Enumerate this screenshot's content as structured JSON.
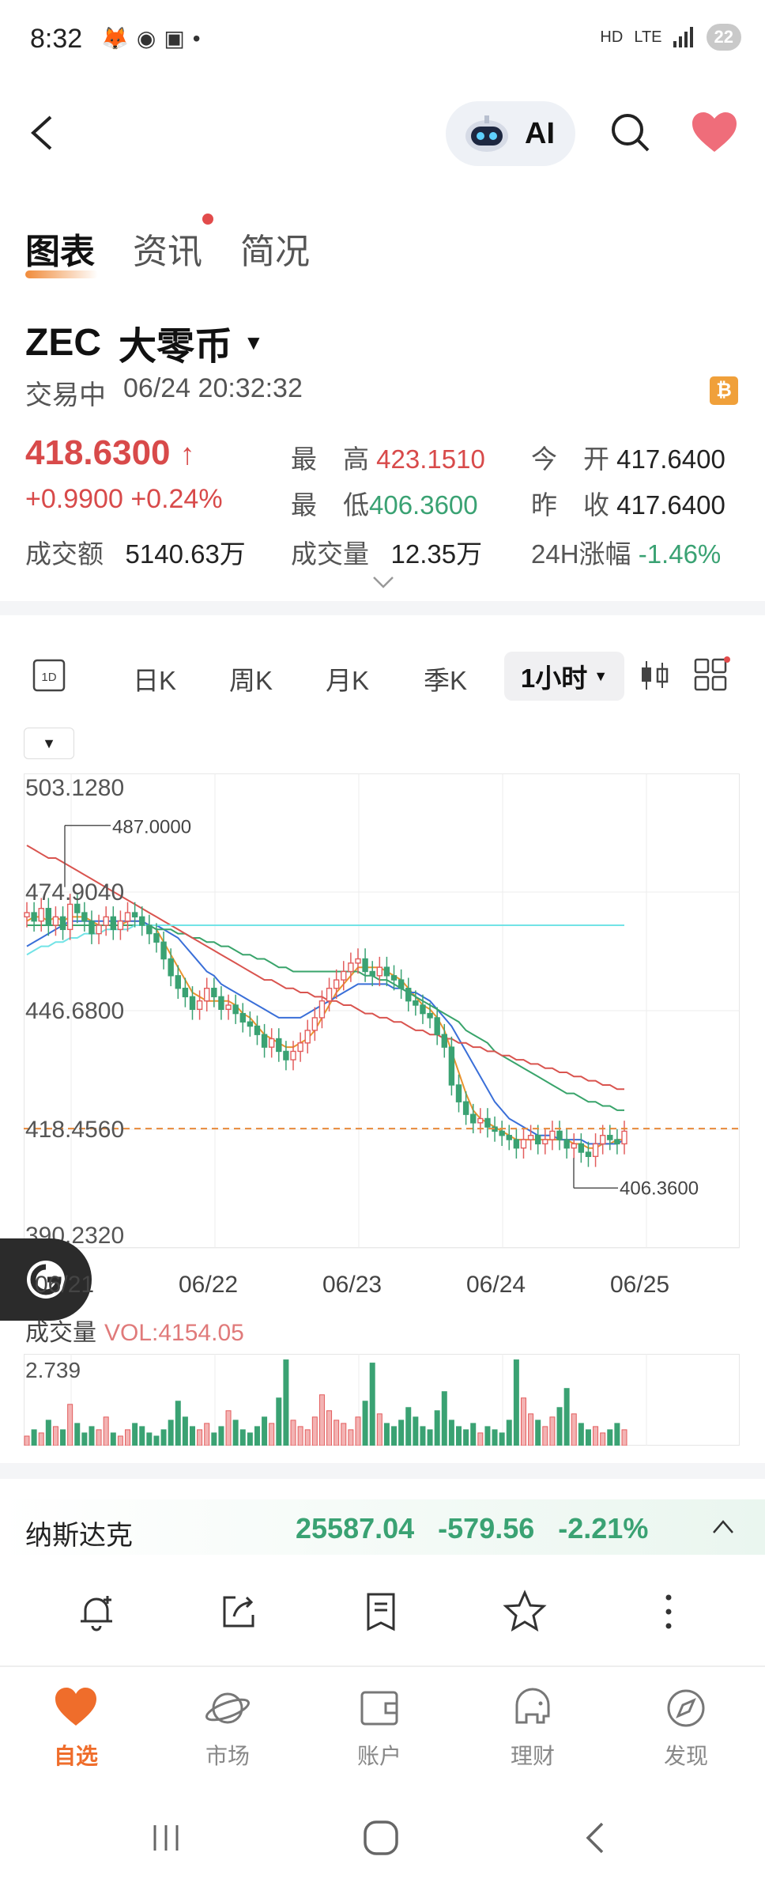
{
  "status_bar": {
    "time": "8:32",
    "network": "HD",
    "lte": "LTE",
    "battery": "22"
  },
  "header": {
    "ai_label": "AI"
  },
  "tabs": [
    {
      "label": "图表",
      "active": true
    },
    {
      "label": "资讯",
      "has_dot": true
    },
    {
      "label": "简况"
    }
  ],
  "ticker": {
    "symbol": "ZEC",
    "name": "大零币",
    "status": "交易中",
    "datetime": "06/24 20:32:32",
    "coin_badge": "₿"
  },
  "quote": {
    "price": "418.6300",
    "arrow": "↑",
    "change": "+0.9900",
    "change_pct": "+0.24%",
    "high_label": "最　高",
    "high": "423.1510",
    "low_label": "最　低",
    "low": "406.3600",
    "open_label": "今　开",
    "open": "417.6400",
    "prev_label": "昨　收",
    "prev_close": "417.6400",
    "turnover_label": "成交额",
    "turnover": "5140.63万",
    "volume_label": "成交量",
    "volume": "12.35万",
    "chg24_label": "24H涨幅",
    "chg24": "-1.46%"
  },
  "chart_toolbar": {
    "period_icon_label": "1D",
    "items": [
      "日K",
      "周K",
      "月K",
      "季K"
    ],
    "selected": "1小时"
  },
  "chart_data": {
    "type": "candlestick",
    "price_ticks": [
      "503.1280",
      "474.9040",
      "446.6800",
      "418.4560",
      "390.2320"
    ],
    "date_ticks": [
      "06/21",
      "06/22",
      "06/23",
      "06/24",
      "06/25"
    ],
    "ylim": [
      390.232,
      503.128
    ],
    "max_annotation": "487.0000",
    "min_annotation": "406.3600",
    "current_price_line": 418.63,
    "close_series": [
      470,
      468,
      471,
      467,
      469,
      466,
      472,
      470,
      468,
      465,
      467,
      469,
      466,
      468,
      470,
      469,
      467,
      465,
      463,
      459,
      455,
      452,
      450,
      447,
      449,
      452,
      450,
      447,
      448,
      446,
      444,
      443,
      441,
      438,
      440,
      437,
      435,
      437,
      439,
      442,
      445,
      449,
      452,
      454,
      456,
      458,
      459,
      456,
      455,
      457,
      455,
      454,
      452,
      449,
      448,
      446,
      445,
      441,
      438,
      429,
      425,
      422,
      420,
      421,
      419,
      418,
      417,
      416,
      414,
      416,
      417,
      415,
      416,
      418,
      416,
      414,
      415,
      413,
      412,
      415,
      417,
      416,
      415,
      418
    ],
    "ma_series": [
      {
        "name": "MA5",
        "color": "#e8932e",
        "values": [
          468,
          469,
          469,
          468,
          469,
          468,
          469,
          469,
          469,
          468,
          467,
          467,
          467,
          467,
          468,
          468,
          468,
          467,
          466,
          463,
          460,
          457,
          454,
          451,
          450,
          449,
          449,
          449,
          449,
          448,
          446,
          445,
          443,
          441,
          440,
          439,
          438,
          438,
          439,
          440,
          442,
          445,
          448,
          451,
          453,
          455,
          457,
          457,
          457,
          457,
          456,
          455,
          454,
          452,
          450,
          448,
          447,
          445,
          442,
          437,
          432,
          427,
          423,
          421,
          420,
          419,
          418,
          417,
          416,
          416,
          416,
          416,
          416,
          416,
          416,
          416,
          415,
          415,
          414,
          414,
          415,
          415,
          416,
          416
        ]
      },
      {
        "name": "MA10",
        "color": "#3a6fd8",
        "values": [
          462,
          463,
          464,
          465,
          466,
          467,
          468,
          468,
          468,
          468,
          468,
          468,
          468,
          468,
          468,
          468,
          468,
          467,
          467,
          466,
          465,
          464,
          462,
          460,
          458,
          456,
          455,
          453,
          452,
          451,
          450,
          449,
          448,
          447,
          446,
          445,
          445,
          445,
          445,
          446,
          447,
          448,
          449,
          450,
          451,
          452,
          453,
          453,
          453,
          453,
          453,
          452,
          452,
          451,
          451,
          450,
          449,
          447,
          445,
          443,
          440,
          437,
          434,
          431,
          428,
          425,
          423,
          421,
          420,
          419,
          418,
          417,
          417,
          417,
          416,
          416,
          416,
          416,
          415,
          415,
          415,
          415,
          415,
          416
        ]
      },
      {
        "name": "MA30",
        "color": "#39a46b",
        "values": [
          467,
          467,
          467,
          467,
          467,
          467,
          467,
          467,
          467,
          467,
          467,
          467,
          467,
          467,
          467,
          467,
          467,
          467,
          466,
          466,
          466,
          465,
          465,
          464,
          464,
          463,
          463,
          462,
          462,
          461,
          460,
          460,
          459,
          459,
          458,
          457,
          457,
          456,
          456,
          456,
          456,
          456,
          456,
          456,
          456,
          456,
          456,
          455,
          455,
          454,
          454,
          453,
          452,
          451,
          450,
          449,
          448,
          447,
          446,
          445,
          444,
          442,
          441,
          440,
          439,
          437,
          436,
          435,
          434,
          433,
          432,
          431,
          430,
          429,
          428,
          427,
          427,
          426,
          425,
          425,
          424,
          424,
          423,
          423
        ]
      },
      {
        "name": "MA60",
        "color": "#d9544f",
        "values": [
          486,
          485,
          484,
          483,
          483,
          482,
          481,
          480,
          479,
          478,
          477,
          476,
          475,
          474,
          473,
          472,
          471,
          470,
          469,
          468,
          467,
          466,
          465,
          464,
          463,
          462,
          461,
          460,
          459,
          458,
          457,
          456,
          455,
          454,
          454,
          453,
          452,
          452,
          451,
          451,
          450,
          450,
          449,
          449,
          448,
          448,
          447,
          446,
          446,
          445,
          445,
          444,
          444,
          443,
          442,
          442,
          441,
          441,
          440,
          440,
          439,
          439,
          438,
          438,
          437,
          437,
          436,
          436,
          435,
          435,
          434,
          434,
          433,
          433,
          432,
          432,
          431,
          431,
          430,
          430,
          429,
          429,
          428,
          428
        ]
      },
      {
        "name": "MA120",
        "color": "#72e3e6",
        "values": [
          460,
          461,
          462,
          462,
          463,
          463,
          464,
          464,
          465,
          465,
          465,
          466,
          466,
          466,
          466,
          467,
          467,
          467,
          467,
          467,
          467,
          467,
          467,
          467,
          467,
          467,
          467,
          467,
          467,
          467,
          467,
          467,
          467,
          467,
          467,
          467,
          467,
          467,
          467,
          467,
          467,
          467,
          467,
          467,
          467,
          467,
          467,
          467,
          467,
          467,
          467,
          467,
          467,
          467,
          467,
          467,
          467,
          467,
          467,
          467,
          467,
          467,
          467,
          467,
          467,
          467,
          467,
          467,
          467,
          467,
          467,
          467,
          467,
          467,
          467,
          467,
          467,
          467,
          467,
          467,
          467,
          467,
          467,
          467
        ]
      }
    ]
  },
  "volume": {
    "label": "成交量",
    "vol_text": "VOL:4154.05",
    "max_tick": "2.739",
    "values": [
      0.3,
      0.5,
      0.4,
      0.8,
      0.6,
      0.5,
      1.3,
      0.7,
      0.4,
      0.6,
      0.5,
      0.9,
      0.4,
      0.3,
      0.5,
      0.7,
      0.6,
      0.4,
      0.3,
      0.5,
      0.8,
      1.4,
      0.9,
      0.6,
      0.5,
      0.7,
      0.4,
      0.6,
      1.1,
      0.8,
      0.5,
      0.4,
      0.6,
      0.9,
      0.7,
      1.5,
      2.7,
      0.8,
      0.6,
      0.5,
      0.9,
      1.6,
      1.1,
      0.8,
      0.7,
      0.5,
      0.9,
      1.4,
      2.6,
      1.0,
      0.7,
      0.6,
      0.8,
      1.2,
      0.9,
      0.6,
      0.5,
      1.1,
      1.7,
      0.8,
      0.6,
      0.5,
      0.7,
      0.4,
      0.6,
      0.5,
      0.4,
      0.8,
      2.7,
      1.5,
      1.0,
      0.8,
      0.6,
      0.9,
      1.2,
      1.8,
      1.0,
      0.7,
      0.5,
      0.6,
      0.4,
      0.5,
      0.7,
      0.5
    ]
  },
  "index_ticker": {
    "name": "纳斯达克",
    "value": "25587.04",
    "change": "-579.56",
    "change_pct": "-2.21%"
  },
  "bottom_nav": [
    {
      "label": "自选",
      "active": true
    },
    {
      "label": "市场"
    },
    {
      "label": "账户"
    },
    {
      "label": "理财"
    },
    {
      "label": "发现"
    }
  ]
}
